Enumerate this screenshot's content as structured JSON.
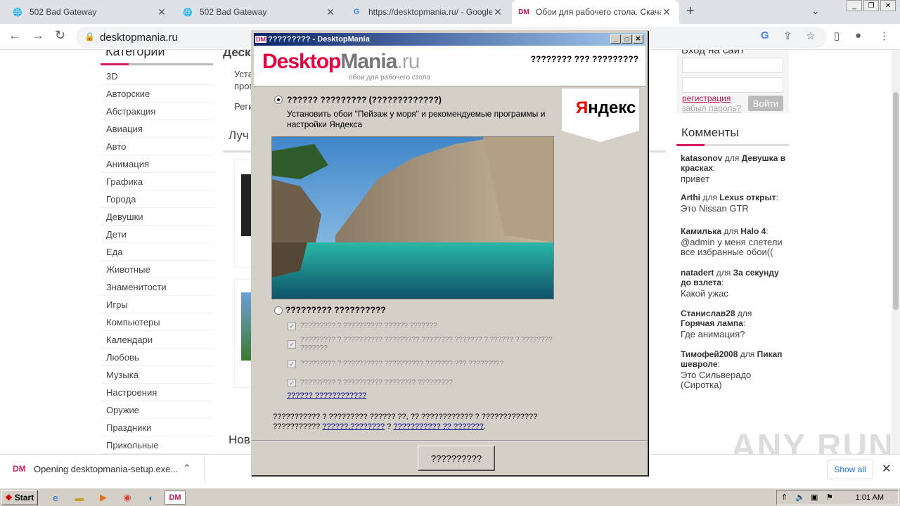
{
  "browser": {
    "tabs": [
      {
        "title": "502 Bad Gateway",
        "icon": "globe-icon"
      },
      {
        "title": "502 Bad Gateway",
        "icon": "globe-icon"
      },
      {
        "title": "https://desktopmania.ru/ - Google S",
        "icon": "google-icon"
      },
      {
        "title": "Обои для рабочего стола. Скачат",
        "icon": "dm-icon"
      }
    ],
    "url": "desktopmania.ru"
  },
  "page": {
    "categories_title": "Категории",
    "categories": [
      "3D",
      "Авторские",
      "Абстракция",
      "Авиация",
      "Авто",
      "Анимация",
      "Графика",
      "Города",
      "Девушки",
      "Дети",
      "Еда",
      "Животные",
      "Знаменитости",
      "Игры",
      "Компьютеры",
      "Календари",
      "Любовь",
      "Музыка",
      "Настроения",
      "Оружие",
      "Праздники",
      "Прикольные"
    ],
    "mid_heading_1": "Деск",
    "mid_text_1": "Уста",
    "mid_text_2": "прог",
    "mid_text_3": "Реги",
    "mid_heading_2": "Луч",
    "mid_heading_3": "Нов",
    "login_title": "Вход на сайт",
    "register_link": "регистрация",
    "forgot_link": "забыл пароль?",
    "login_button": "Войти",
    "comments_title": "Комменты",
    "comments": [
      {
        "user": "katasonov",
        "for": "для",
        "target": "Девушка в красках",
        "text": "привет"
      },
      {
        "user": "Arthi",
        "for": "для",
        "target": "Lexus открыт",
        "text": "Это Nissan GTR"
      },
      {
        "user": "Камилька",
        "for": "для",
        "target": "Halo 4",
        "text": "@admin у меня слетели все избранные обои(("
      },
      {
        "user": "natadert",
        "for": "для",
        "target": "За секунду до взлета",
        "text": "Какой ужас"
      },
      {
        "user": "Станислав28",
        "for": "для",
        "target": "Горячая лампа",
        "text": "Где анимация?"
      },
      {
        "user": "Тимофей2008",
        "for": "для",
        "target": "Пикап шевроле",
        "text": "Это Сильверадо (Сиротка)"
      }
    ]
  },
  "dialog": {
    "title": "????????? - DesktopMania",
    "logo_main": "Desktop",
    "logo_mania": "Mania",
    "logo_ru": ".ru",
    "logo_sub": "обои для рабочего стола",
    "header_text": "???????? ??? ?????????",
    "yandex_y": "Я",
    "yandex_rest": "ндекс",
    "option1_label": "?????? ????????? (?????????????)",
    "option1_desc": "Установить обои \"Пейзаж у моря\" и рекомендуемые программы и настройки Яндекса",
    "option2_label": "????????? ??????????",
    "checkboxes": [
      "????????? ? ?????????? ?????? ???????",
      "????????? ? ?????????? ????????? ???????? ??????? ? ?????? ? ???????? ???????",
      "????????? ? ?????????? ?????????? ??????? ??? ?????????",
      "????????? ? ?????????? ???????? ?????????"
    ],
    "details_link": "?????? ????????????",
    "footer_text": "??????????? ? ????????? ?????? ??, ?? ???????????? ? ????????????? ???????????",
    "footer_link1": "??????.????????",
    "footer_q": "?",
    "footer_link2": "??????????? ?? ???????",
    "install_button": "??????????"
  },
  "download": {
    "text": "Opening desktopmania-setup.exe...",
    "show_all": "Show all"
  },
  "watermark": "ANY RUN",
  "taskbar": {
    "start": "Start",
    "clock": "1:01 AM"
  }
}
